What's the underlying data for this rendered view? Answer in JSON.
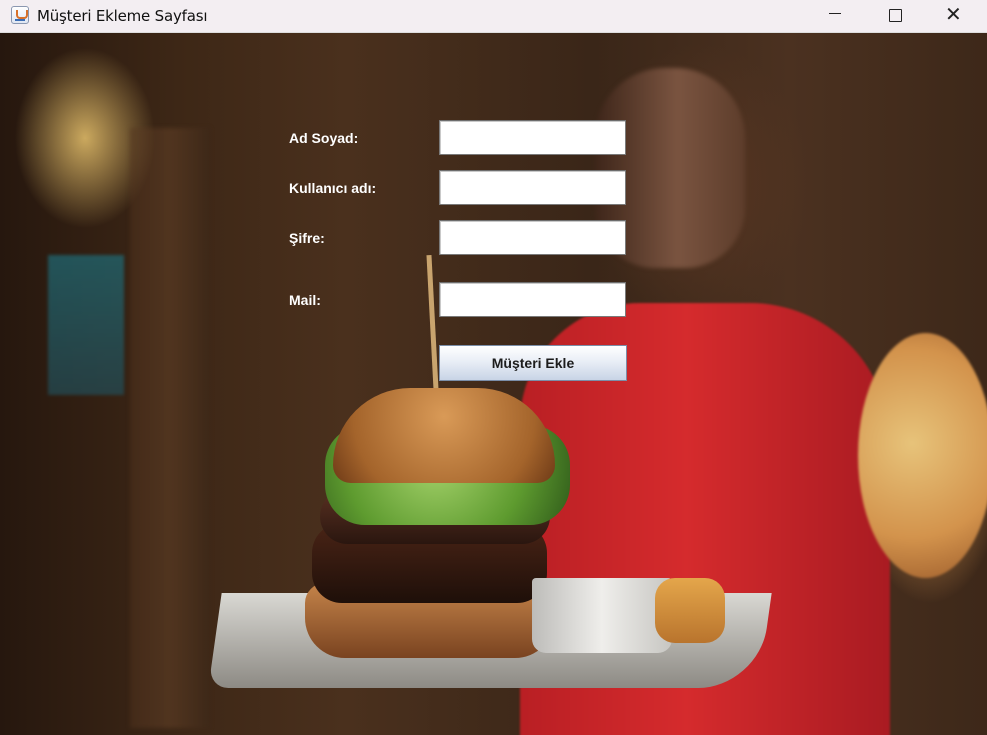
{
  "window": {
    "title": "Müşteri Ekleme Sayfası",
    "controls": {
      "minimize": "—",
      "maximize": "☐",
      "close": "✕"
    }
  },
  "form": {
    "fields": [
      {
        "label": "Ad Soyad:",
        "value": ""
      },
      {
        "label": "Kullanıcı adı:",
        "value": ""
      },
      {
        "label": "Şifre:",
        "value": ""
      },
      {
        "label": "Mail:",
        "value": ""
      }
    ],
    "submit_label": "Müşteri Ekle"
  },
  "icons": {
    "app": "java-app-icon",
    "minimize": "minimize-icon",
    "maximize": "maximize-icon",
    "close": "close-icon"
  }
}
